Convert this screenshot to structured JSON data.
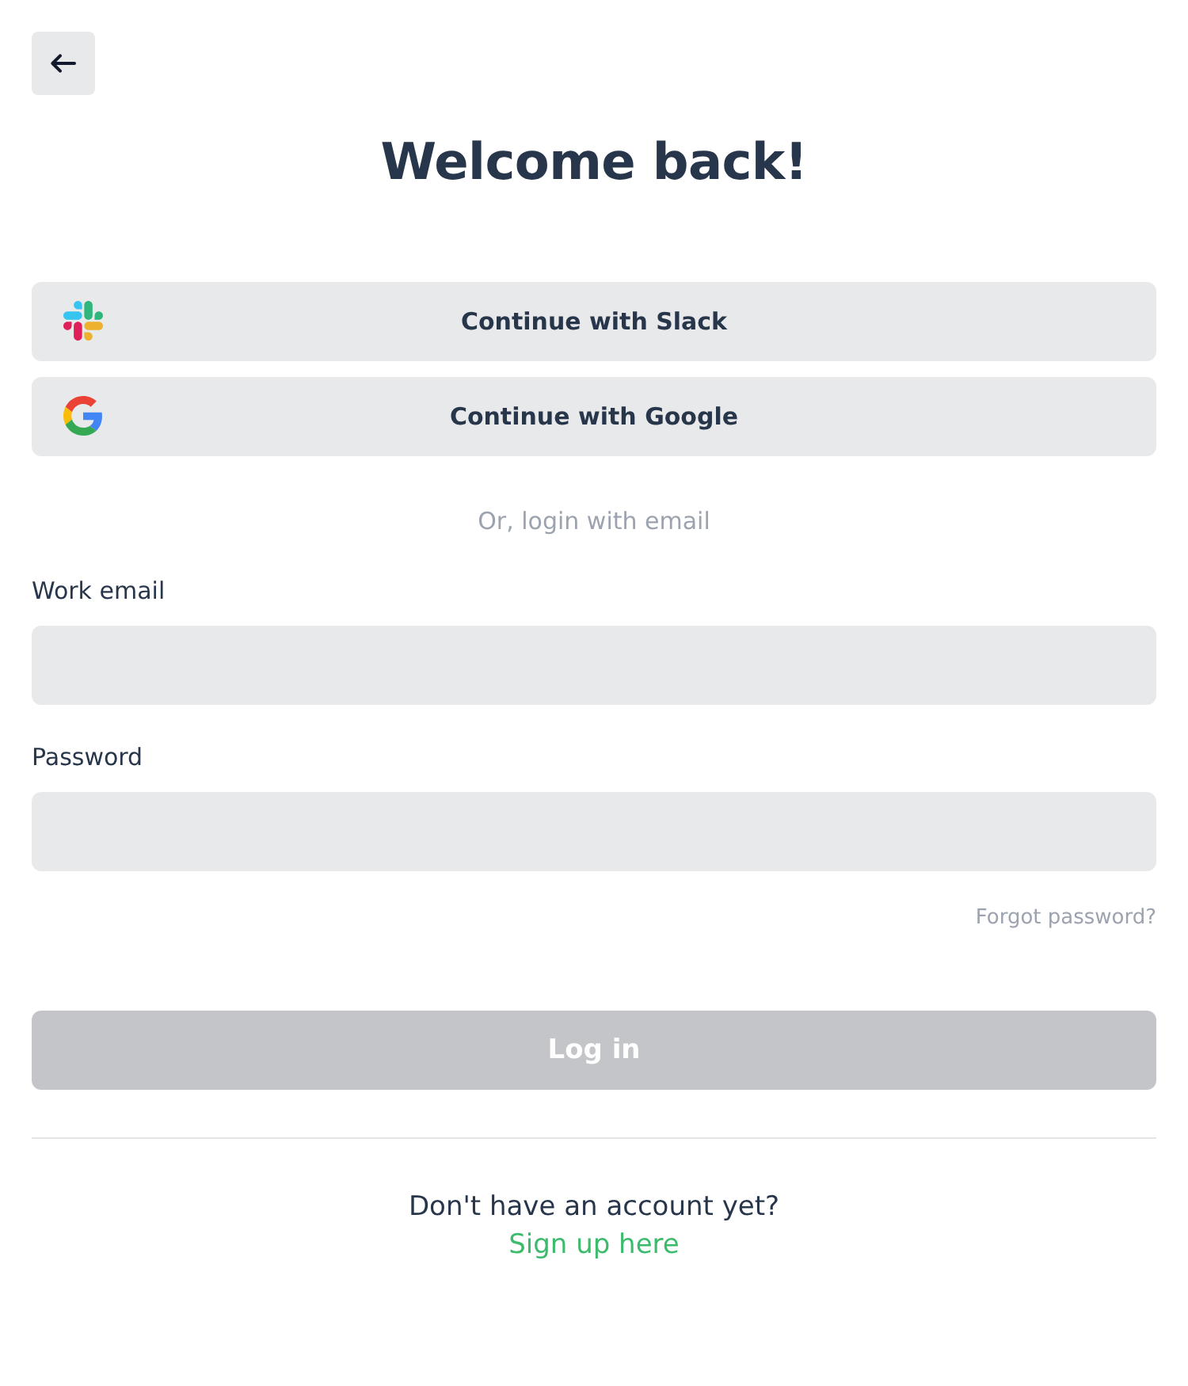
{
  "title": "Welcome back!",
  "social_buttons": [
    {
      "kind": "slack",
      "label": "Continue with Slack"
    },
    {
      "kind": "google",
      "label": "Continue with Google"
    }
  ],
  "separator_text": "Or, login with email",
  "fields": [
    {
      "label": "Work email"
    },
    {
      "label": "Password"
    }
  ],
  "forgot_link": "Forgot password?",
  "login_button": {
    "label": "Log in",
    "disabled": true
  },
  "signup": {
    "prompt": "Don't have an account yet?",
    "link": "Sign up here"
  }
}
